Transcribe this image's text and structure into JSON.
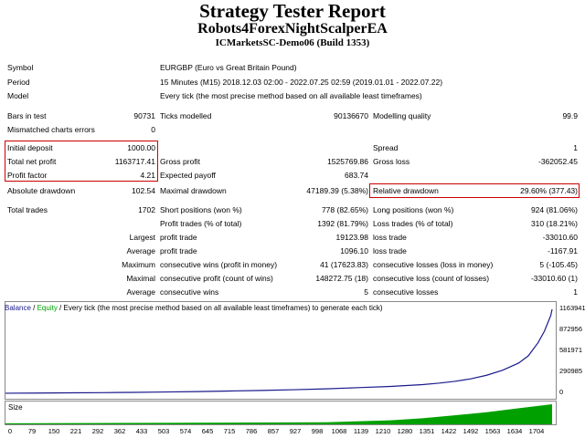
{
  "header": {
    "title": "Strategy Tester Report",
    "ea_name": "Robots4ForexNightScalperEA",
    "account": "ICMarketsSC-Demo06 (Build 1353)"
  },
  "info": {
    "symbol_label": "Symbol",
    "symbol_value": "EURGBP (Euro vs Great Britain Pound)",
    "period_label": "Period",
    "period_value": "15 Minutes (M15) 2018.12.03 02:00 - 2022.07.25 02:59 (2019.01.01 - 2022.07.22)",
    "model_label": "Model",
    "model_value": "Every tick (the most precise method based on all available least timeframes)"
  },
  "stats": {
    "bars_label": "Bars in test",
    "bars_value": "90731",
    "ticks_label": "Ticks modelled",
    "ticks_value": "90136670",
    "quality_label": "Modelling quality",
    "quality_value": "99.9",
    "mismatch_label": "Mismatched charts errors",
    "mismatch_value": "0",
    "deposit_label": "Initial deposit",
    "deposit_value": "1000.00",
    "spread_label": "Spread",
    "spread_value": "1",
    "netprofit_label": "Total net profit",
    "netprofit_value": "1163717.41",
    "grossprofit_label": "Gross profit",
    "grossprofit_value": "1525769.86",
    "grossloss_label": "Gross loss",
    "grossloss_value": "-362052.45",
    "pf_label": "Profit factor",
    "pf_value": "4.21",
    "payoff_label": "Expected payoff",
    "payoff_value": "683.74",
    "absdd_label": "Absolute drawdown",
    "absdd_value": "102.54",
    "maxdd_label": "Maximal drawdown",
    "maxdd_value": "47189.39 (5.38%)",
    "reldd_label": "Relative drawdown",
    "reldd_value": "29.60% (377.43)",
    "trades_label": "Total trades",
    "trades_value": "1702",
    "short_label": "Short positions (won %)",
    "short_value": "778 (82.65%)",
    "long_label": "Long positions (won %)",
    "long_value": "924 (81.06%)",
    "profittrades_label": "Profit trades (% of total)",
    "profittrades_value": "1392 (81.79%)",
    "losstrades_label": "Loss trades (% of total)",
    "losstrades_value": "310 (18.21%)",
    "largest_label": "Largest",
    "lp_label": "profit trade",
    "lp_value": "19123.98",
    "ll_label": "loss trade",
    "ll_value": "-33010.60",
    "average_label": "Average",
    "ap_label": "profit trade",
    "ap_value": "1096.10",
    "al_label": "loss trade",
    "al_value": "-1167.91",
    "maximum_label": "Maximum",
    "mcw_label": "consecutive wins (profit in money)",
    "mcw_value": "41 (17623.83)",
    "mcl_label": "consecutive losses (loss in money)",
    "mcl_value": "5 (-105.45)",
    "maximal_label": "Maximal",
    "mcp_label": "consecutive profit (count of wins)",
    "mcp_value": "148272.75 (18)",
    "mclc_label": "consecutive loss (count of losses)",
    "mclc_value": "-33010.60 (1)",
    "average2_label": "Average",
    "acw_label": "consecutive wins",
    "acw_value": "5",
    "acl_label": "consecutive losses",
    "acl_value": "1"
  },
  "legend": {
    "balance": "Balance",
    "sep1": " / ",
    "equity": "Equity",
    "rest": " / Every tick (the most precise method based on all available least timeframes) to generate each tick)"
  },
  "size_label": "Size",
  "colors": {
    "balance": "#1a1a8c",
    "equity": "#00a000",
    "highlight": "#cc0000"
  },
  "chart_data": {
    "type": "line",
    "xlabel": "",
    "ylabel": "",
    "y_ticks": [
      "1163941",
      "872956",
      "581971",
      "290985",
      "0"
    ],
    "x_ticks": [
      "0",
      "79",
      "150",
      "221",
      "292",
      "362",
      "433",
      "503",
      "574",
      "645",
      "715",
      "786",
      "857",
      "927",
      "998",
      "1068",
      "1139",
      "1210",
      "1280",
      "1351",
      "1422",
      "1492",
      "1563",
      "1634",
      "1704"
    ],
    "ylim": [
      0,
      1163941
    ],
    "xlim": [
      0,
      1704
    ],
    "series": [
      {
        "name": "Balance",
        "x": [
          0,
          100,
          200,
          300,
          400,
          500,
          600,
          700,
          800,
          900,
          1000,
          1100,
          1200,
          1300,
          1350,
          1400,
          1450,
          1500,
          1550,
          1600,
          1630,
          1660,
          1680,
          1700,
          1704
        ],
        "values": [
          1000,
          3000,
          6000,
          9000,
          13000,
          18000,
          24000,
          32000,
          40000,
          50000,
          62000,
          78000,
          95000,
          120000,
          140000,
          165000,
          200000,
          250000,
          320000,
          420000,
          520000,
          700000,
          860000,
          1080000,
          1163717
        ]
      }
    ],
    "size_series": {
      "x": [
        0,
        1000,
        1200,
        1300,
        1400,
        1500,
        1600,
        1704
      ],
      "values": [
        0.05,
        0.1,
        0.2,
        0.3,
        0.45,
        0.6,
        0.8,
        1.0
      ]
    },
    "grid": false
  }
}
